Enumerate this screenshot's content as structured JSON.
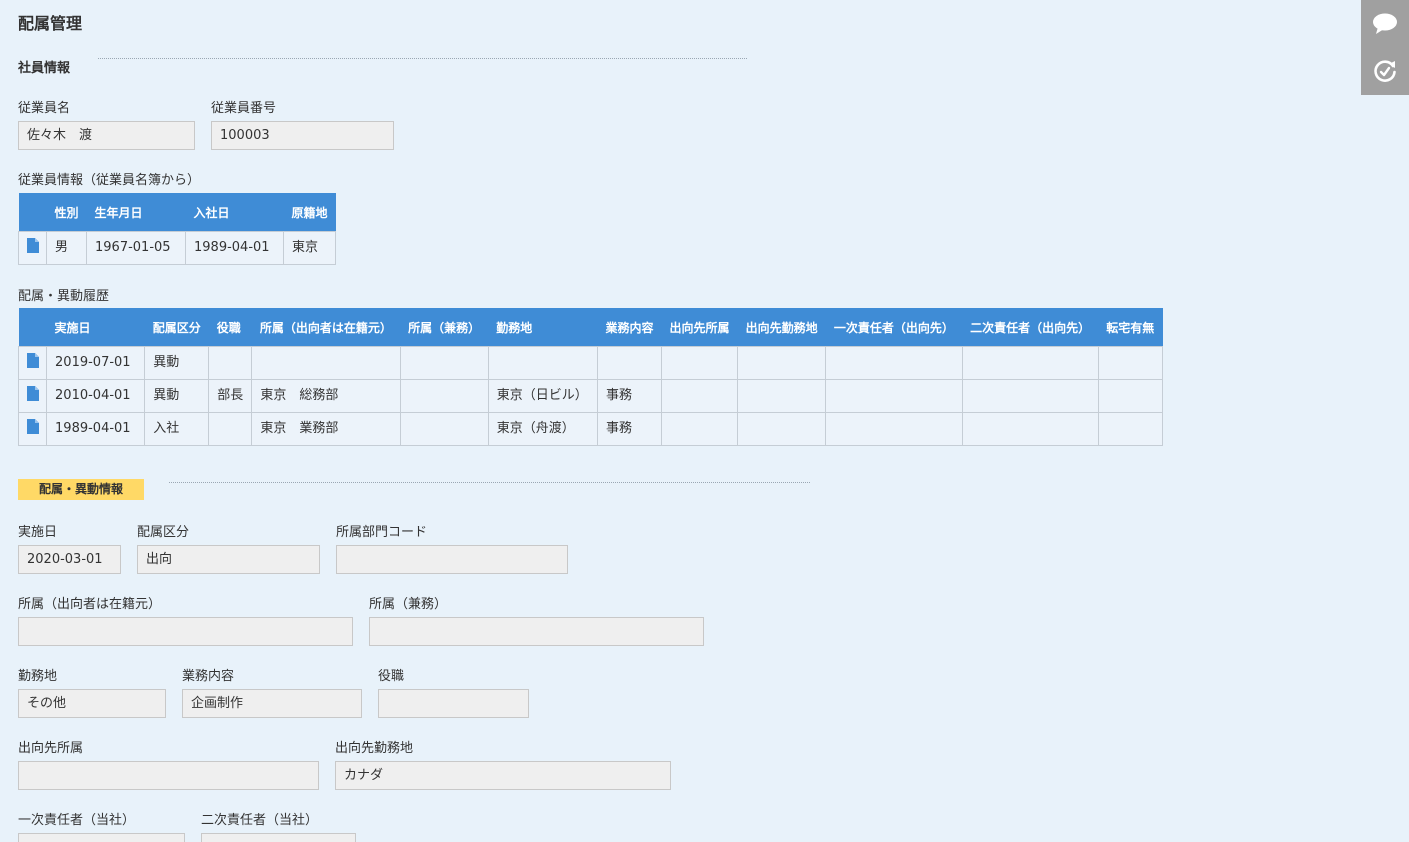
{
  "page_title": "配属管理",
  "employee_section": {
    "title": "社員情報",
    "name_label": "従業員名",
    "name_value": "佐々木　渡",
    "number_label": "従業員番号",
    "number_value": "100003",
    "info_label": "従業員情報（従業員名簿から）",
    "info_table": {
      "headers": [
        "性別",
        "生年月日",
        "入社日",
        "原籍地"
      ],
      "rows": [
        [
          "男",
          "1967-01-05",
          "1989-04-01",
          "東京"
        ]
      ]
    }
  },
  "history_section": {
    "label": "配属・異動履歴",
    "headers": [
      "実施日",
      "配属区分",
      "役職",
      "所属（出向者は在籍元）",
      "所属（兼務）",
      "勤務地",
      "業務内容",
      "出向先所属",
      "出向先勤務地",
      "一次責任者（出向先）",
      "二次責任者（出向先）",
      "転宅有無"
    ],
    "rows": [
      [
        "2019-07-01",
        "異動",
        "",
        "",
        "",
        "",
        "",
        "",
        "",
        "",
        "",
        ""
      ],
      [
        "2010-04-01",
        "異動",
        "部長",
        "東京　総務部",
        "",
        "東京（日ビル）",
        "事務",
        "",
        "",
        "",
        "",
        ""
      ],
      [
        "1989-04-01",
        "入社",
        "",
        "東京　業務部",
        "",
        "東京（舟渡）",
        "事務",
        "",
        "",
        "",
        "",
        ""
      ]
    ]
  },
  "transfer_section": {
    "title": "配属・異動情報",
    "date_label": "実施日",
    "date_value": "2020-03-01",
    "category_label": "配属区分",
    "category_value": "出向",
    "dept_code_label": "所属部門コード",
    "dept_code_value": "",
    "affiliation_label": "所属（出向者は在籍元）",
    "affiliation_value": "",
    "concurrent_label": "所属（兼務）",
    "concurrent_value": "",
    "workplace_label": "勤務地",
    "workplace_value": "その他",
    "duties_label": "業務内容",
    "duties_value": "企画制作",
    "position_label": "役職",
    "position_value": "",
    "dest_affiliation_label": "出向先所属",
    "dest_affiliation_value": "",
    "dest_workplace_label": "出向先勤務地",
    "dest_workplace_value": "カナダ",
    "primary_label": "一次責任者（当社）",
    "primary_value": "",
    "secondary_label": "二次責任者（当社）",
    "secondary_value": ""
  },
  "side_panel": {
    "icons": [
      "comment-icon",
      "history-icon"
    ]
  },
  "colors": {
    "background": "#e8f2fa",
    "table_header": "#3f8cd6",
    "highlight": "#ffd966",
    "side_panel": "#a0a0a0",
    "doc_icon": "#3f8cd6"
  }
}
